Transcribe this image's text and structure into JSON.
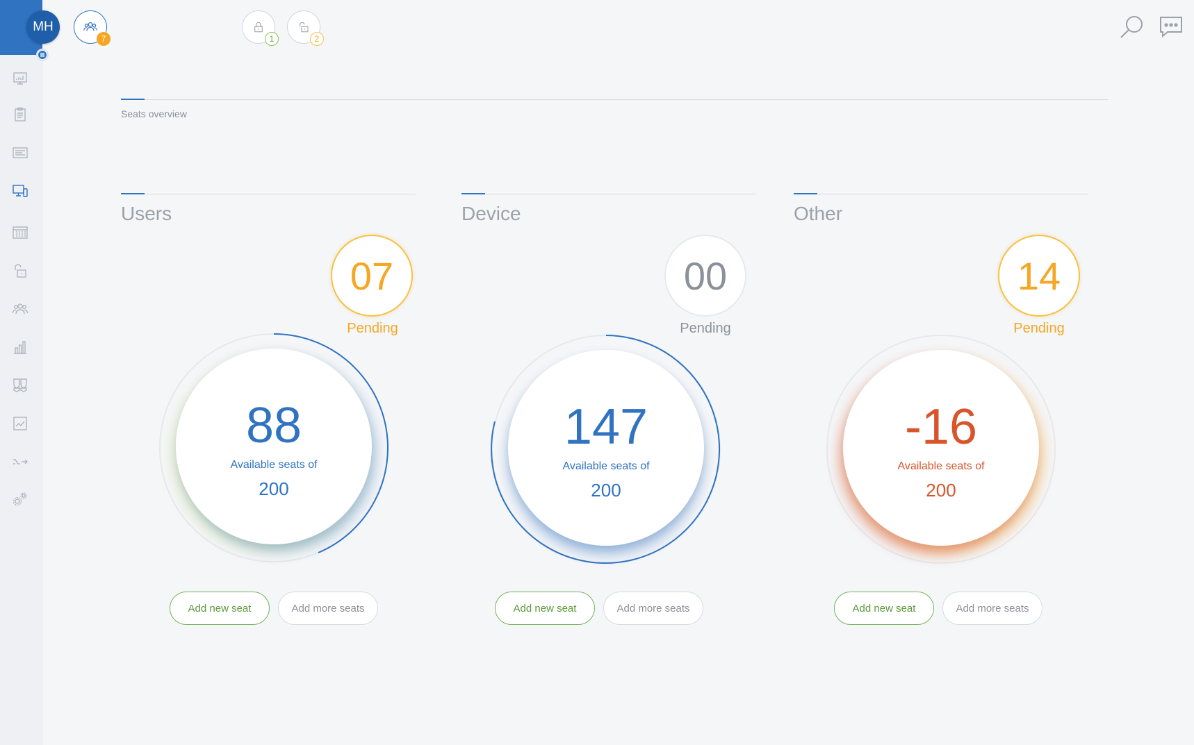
{
  "header": {
    "avatar_initials": "MH",
    "users_badge": "7",
    "locked_badge": "1",
    "unlocked_badge": "2"
  },
  "sidebar": {
    "icons": [
      "dashboard-icon",
      "clipboard-icon",
      "list-icon",
      "devices-icon",
      "grid-icon",
      "unlock-icon",
      "users-icon",
      "bar-chart-icon",
      "shields-icon",
      "trend-chart-icon",
      "shuffle-icon",
      "gears-icon"
    ]
  },
  "page": {
    "section_title": "Seats overview"
  },
  "panels": [
    {
      "title": "Users",
      "pending_value": "07",
      "pending_label": "Pending",
      "available": "88",
      "available_label": "Available seats of",
      "total": "200",
      "add_new_label": "Add new seat",
      "add_more_label": "Add more seats"
    },
    {
      "title": "Device",
      "pending_value": "00",
      "pending_label": "Pending",
      "available": "147",
      "available_label": "Available seats of",
      "total": "200",
      "add_new_label": "Add new seat",
      "add_more_label": "Add more seats"
    },
    {
      "title": "Other",
      "pending_value": "14",
      "pending_label": "Pending",
      "available": "-16",
      "available_label": "Available seats of",
      "total": "200",
      "add_new_label": "Add new seat",
      "add_more_label": "Add more seats"
    }
  ],
  "colors": {
    "brand": "#2f73c1",
    "pending_orange": "#f5a623",
    "green": "#79b15a",
    "negative": "#d9542b",
    "grey_text": "#8a9199"
  }
}
